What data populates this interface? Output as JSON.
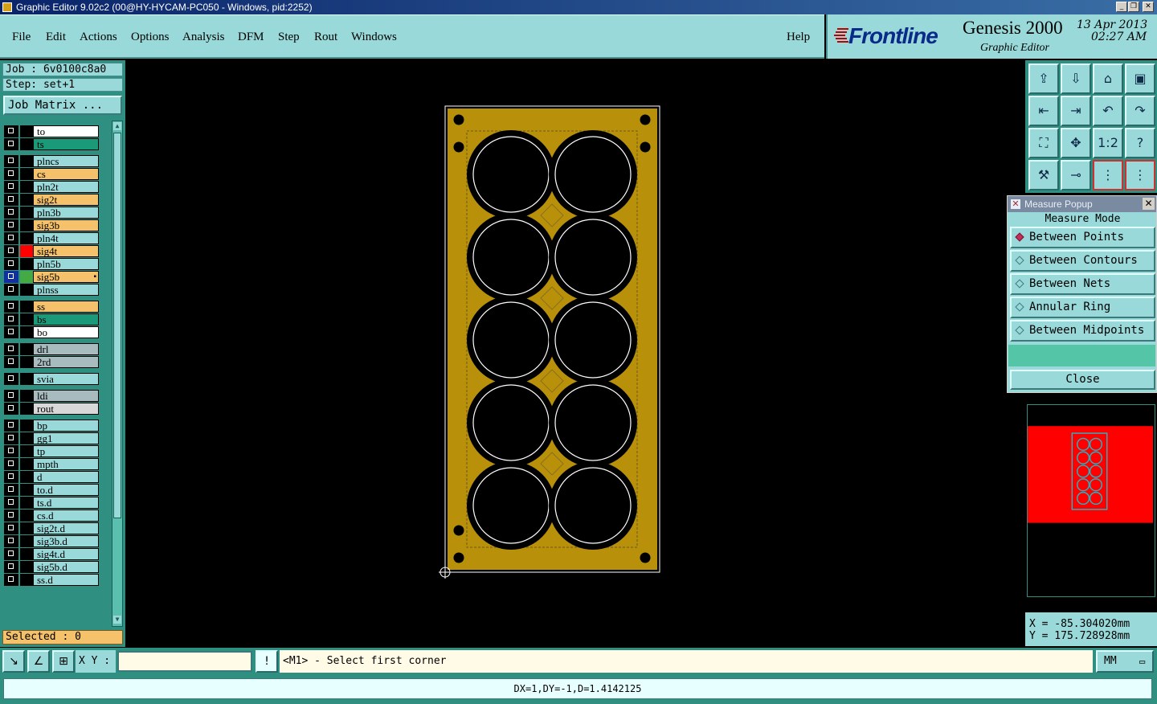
{
  "window": {
    "title": "Graphic Editor 9.02c2 (00@HY-HYCAM-PC050 - Windows, pid:2252)",
    "controls": [
      "_",
      "❐",
      "✕"
    ]
  },
  "menu": {
    "items": [
      "File",
      "Edit",
      "Actions",
      "Options",
      "Analysis",
      "DFM",
      "Step",
      "Rout",
      "Windows"
    ],
    "help": "Help"
  },
  "brand": {
    "logo": "Frontline",
    "product": "Genesis 2000",
    "subtitle": "Graphic Editor",
    "date": "13 Apr 2013",
    "time": "02:27 AM"
  },
  "job": {
    "job_line": "Job : 6v0100c8a0",
    "step_line": "Step: set+1",
    "matrix_button": "Job Matrix ..."
  },
  "layers": [
    {
      "name": "to",
      "color": "#ffffff"
    },
    {
      "name": "ts",
      "color": "#1a9a78"
    },
    {
      "name": "plncs",
      "color": "#9ad9d9"
    },
    {
      "name": "cs",
      "color": "#f5c26b"
    },
    {
      "name": "pln2t",
      "color": "#9ad9d9"
    },
    {
      "name": "sig2t",
      "color": "#f5c26b"
    },
    {
      "name": "pln3b",
      "color": "#9ad9d9"
    },
    {
      "name": "sig3b",
      "color": "#f5c26b"
    },
    {
      "name": "pln4t",
      "color": "#9ad9d9"
    },
    {
      "name": "sig4t",
      "color": "#f5c26b",
      "swatch": "#ff0000"
    },
    {
      "name": "pln5b",
      "color": "#9ad9d9"
    },
    {
      "name": "sig5b",
      "color": "#f5c26b",
      "swatch": "#44aa44",
      "active": true
    },
    {
      "name": "plnss",
      "color": "#9ad9d9"
    },
    {
      "name": "ss",
      "color": "#f5c26b"
    },
    {
      "name": "bs",
      "color": "#1a9a78"
    },
    {
      "name": "bo",
      "color": "#ffffff"
    },
    {
      "name": "drl",
      "color": "#a8bcc0"
    },
    {
      "name": "2rd",
      "color": "#a8bcc0"
    },
    {
      "name": "svia",
      "color": "#9ad9d9"
    },
    {
      "name": "ldi",
      "color": "#a8bcc0"
    },
    {
      "name": "rout",
      "color": "#d8d8d8"
    },
    {
      "name": "bp",
      "color": "#9ad9d9"
    },
    {
      "name": "gg1",
      "color": "#9ad9d9"
    },
    {
      "name": "tp",
      "color": "#9ad9d9"
    },
    {
      "name": "mpth",
      "color": "#9ad9d9"
    },
    {
      "name": "d",
      "color": "#9ad9d9"
    },
    {
      "name": "to.d",
      "color": "#9ad9d9"
    },
    {
      "name": "ts.d",
      "color": "#9ad9d9"
    },
    {
      "name": "cs.d",
      "color": "#9ad9d9"
    },
    {
      "name": "sig2t.d",
      "color": "#9ad9d9"
    },
    {
      "name": "sig3b.d",
      "color": "#9ad9d9"
    },
    {
      "name": "sig4t.d",
      "color": "#9ad9d9"
    },
    {
      "name": "sig5b.d",
      "color": "#9ad9d9"
    },
    {
      "name": "ss.d",
      "color": "#9ad9d9"
    }
  ],
  "selected": "Selected : 0",
  "toolbar_icons": [
    "upload-icon",
    "download-icon",
    "home-icon",
    "panel-icon",
    "step-in-icon",
    "step-out-icon",
    "undo-icon",
    "redo-icon",
    "zoom-fit-icon",
    "zoom-center-icon",
    "ratio-icon",
    "help-icon",
    "tools-icon",
    "snap-icon",
    "nets-red-icon",
    "nets-blue-icon"
  ],
  "toolbar_texts": {
    "ratio": "1:2",
    "help": "?"
  },
  "measure_popup": {
    "title": "Measure Popup",
    "mode_label": "Measure Mode",
    "options": [
      {
        "label": "Between Points",
        "selected": true
      },
      {
        "label": "Between Contours",
        "selected": false
      },
      {
        "label": "Between Nets",
        "selected": false
      },
      {
        "label": "Annular Ring",
        "selected": false
      },
      {
        "label": "Between Midpoints",
        "selected": false
      }
    ],
    "close": "Close"
  },
  "coords": {
    "x": "X = -85.304020mm",
    "y": "Y = 175.728928mm"
  },
  "bottom": {
    "xy_label": "X Y :",
    "xy_value": "",
    "prompt": "<M1> - Select first corner",
    "units": "MM",
    "status": "DX=1,DY=-1,D=1.4142125"
  },
  "colors": {
    "copper": "#b8900a",
    "background": "#000000",
    "panel": "#9ad9d9",
    "frame": "#2f8f80"
  }
}
